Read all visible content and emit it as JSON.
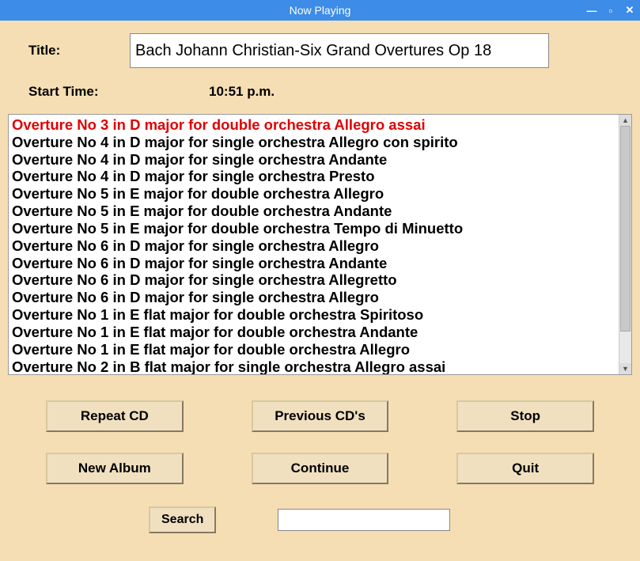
{
  "window": {
    "title": "Now Playing"
  },
  "fields": {
    "title_label": "Title:",
    "title_value": "Bach Johann Christian-Six Grand Overtures Op 18",
    "start_label": "Start Time:",
    "start_value": "10:51 p.m."
  },
  "tracks": [
    "Overture No 3 in D major for double orchestra Allegro assai",
    "Overture No 4 in D major for single orchestra Allegro con spirito",
    "Overture No 4 in D major for single orchestra Andante",
    "Overture No 4 in D major for single orchestra Presto",
    "Overture No 5 in E major for double orchestra Allegro",
    "Overture No 5 in E major for double orchestra Andante",
    "Overture No 5 in E major for double orchestra Tempo di Minuetto",
    "Overture No 6 in D major for single orchestra Allegro",
    "Overture No 6 in D major for single orchestra Andante",
    "Overture No 6 in D major for single orchestra Allegretto",
    "Overture No 6 in D major for single orchestra Allegro",
    "Overture No 1 in E flat major for double orchestra Spiritoso",
    "Overture No 1 in E flat major for double orchestra Andante",
    "Overture No 1 in E flat major for double orchestra Allegro",
    "Overture No 2 in B flat major for single orchestra Allegro assai"
  ],
  "current_track_index": 0,
  "buttons": {
    "repeat": "Repeat CD",
    "previous": "Previous CD's",
    "stop": "Stop",
    "new_album": "New Album",
    "continue": "Continue",
    "quit": "Quit",
    "search": "Search"
  },
  "search": {
    "value": ""
  }
}
